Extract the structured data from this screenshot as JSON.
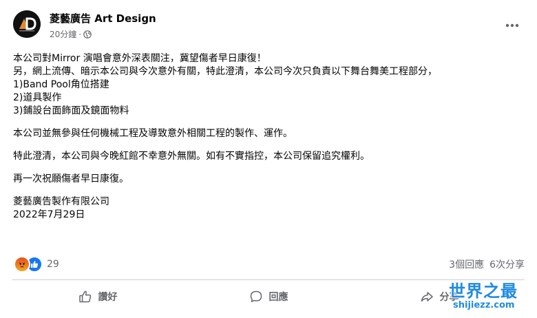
{
  "post": {
    "author": "菱藝廣告 Art Design",
    "timestamp": "20分鐘",
    "timestamp_sep": "·",
    "privacy_icon": "globe-icon",
    "more_icon": "more-horizontal-icon"
  },
  "content": {
    "line1": "本公司對Mirror 演唱會意外深表關注，冀望傷者早日康復！",
    "line2": "另，網上流傳、暗示本公司與今次意外有關，特此澄清，本公司今次只負責以下舞台舞美工程部分，",
    "item1": "1)Band Pool角位搭建",
    "item2": "2)道具製作",
    "item3": "3)鋪設台面飾面及鏡面物料",
    "para2": "本公司並無參與任何機械工程及導致意外相關工程的製作、運作。",
    "para3": "特此澄清，本公司與今晚紅館不幸意外無關。如有不實指控，本公司保留追究權利。",
    "para4": "再一次祝願傷者早日康復。",
    "signature": "菱藝廣告製作有限公司",
    "date": "2022年7月29日"
  },
  "reactions": {
    "icons": [
      "angry-reaction-icon",
      "like-reaction-icon"
    ],
    "count": "29"
  },
  "stats": {
    "comments": "3個回應",
    "shares": "6次分享"
  },
  "actions": {
    "like": "讚好",
    "comment": "回應",
    "share": "分享"
  },
  "watermark": {
    "title": "世界之最",
    "url": "shijiezz.com"
  },
  "colors": {
    "text": "#050505",
    "secondary": "#65676b",
    "divider": "#ced0d4",
    "like_blue": "#1877f2",
    "watermark_blue": "#1e8be0"
  }
}
